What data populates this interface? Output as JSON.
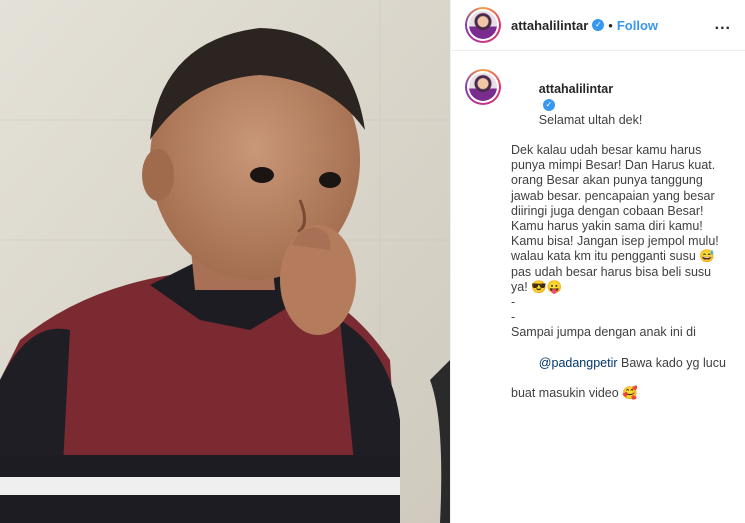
{
  "post": {
    "username": "attahalilintar",
    "verified_icon": "verified-badge-icon",
    "separator": "•",
    "follow_label": "Follow",
    "more_label": "..."
  },
  "caption": {
    "username": "attahalilintar",
    "line1": "Selamat ultah dek!",
    "lines": [
      "Dek kalau udah besar kamu harus",
      "punya mimpi Besar! Dan Harus kuat.",
      "orang Besar akan punya tanggung",
      "jawab besar. pencapaian yang besar",
      "diiringi juga dengan cobaan Besar!",
      "Kamu harus yakin sama diri kamu!",
      "Kamu bisa! Jangan isep jempol mulu!",
      "walau kata km itu pengganti susu 😅",
      "pas udah besar harus bisa beli susu",
      "ya! 😎😛",
      "-",
      "-",
      "Sampai jumpa dengan anak ini di"
    ],
    "mention": "@padangpetir",
    "after_mention": " Bawa kado yg lucu",
    "last_line": "buat masukin video 🥰"
  },
  "colors": {
    "accent": "#3897f0",
    "mention": "#00376b"
  }
}
